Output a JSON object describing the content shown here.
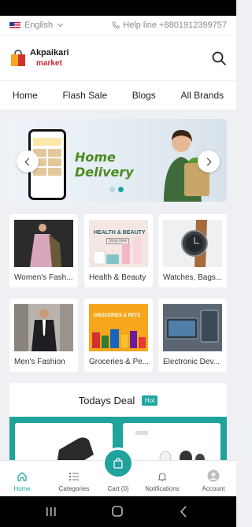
{
  "topbar": {
    "language": "English",
    "helpline": "Help line +8801912399757"
  },
  "logo": {
    "line1": "Akpaikari",
    "line2": "market"
  },
  "nav": [
    "Home",
    "Flash Sale",
    "Blogs",
    "All Brands"
  ],
  "banner": {
    "title_line1": "Home",
    "title_line2": "Delivery",
    "slides": 2,
    "active_slide": 2
  },
  "categories": [
    {
      "label": "Women's Fash...",
      "icon": "dress-image"
    },
    {
      "label": "Health & Beauty",
      "icon": "cosmetics-image",
      "image_text": "HEALTH & BEAUTY",
      "image_button": "Shop Now"
    },
    {
      "label": "Watches, Bags...",
      "icon": "watch-image"
    },
    {
      "label": "Men's Fashion",
      "icon": "suit-image"
    },
    {
      "label": "Groceries & Pe...",
      "icon": "groceries-image",
      "image_text": "GROCERIES & PETS"
    },
    {
      "label": "Electronic Dev...",
      "icon": "tablet-image"
    }
  ],
  "deal": {
    "title": "Todays Deal",
    "badge": "Hot"
  },
  "tabs": [
    {
      "label": "Home",
      "icon": "home-icon",
      "active": true
    },
    {
      "label": "Categories",
      "icon": "categories-icon"
    },
    {
      "label": "Cart (0)",
      "icon": "cart-bag-icon"
    },
    {
      "label": "Notifications",
      "icon": "bell-icon"
    },
    {
      "label": "Account",
      "icon": "avatar-icon"
    }
  ],
  "colors": {
    "accent": "#1fa39c",
    "logo_red": "#c0272d",
    "banner_green": "#4a8a1f"
  }
}
